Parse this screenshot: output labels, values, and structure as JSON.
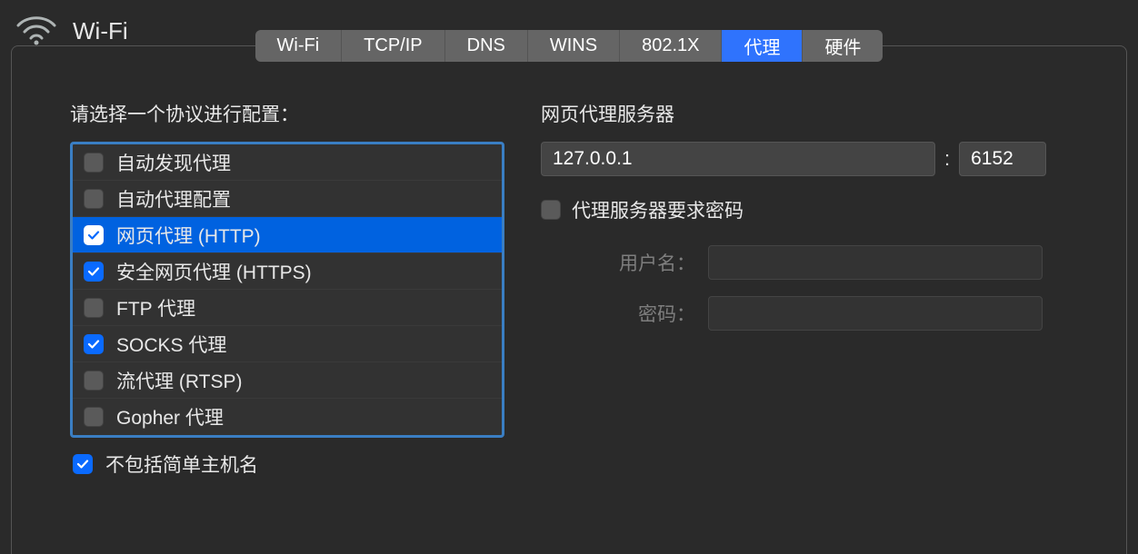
{
  "header": {
    "title": "Wi-Fi"
  },
  "tabs": [
    {
      "label": "Wi-Fi"
    },
    {
      "label": "TCP/IP"
    },
    {
      "label": "DNS"
    },
    {
      "label": "WINS"
    },
    {
      "label": "802.1X"
    },
    {
      "label": "代理"
    },
    {
      "label": "硬件"
    }
  ],
  "left": {
    "section_label": "请选择一个协议进行配置：",
    "protocols": [
      {
        "label": "自动发现代理",
        "checked": false,
        "selected": false
      },
      {
        "label": "自动代理配置",
        "checked": false,
        "selected": false
      },
      {
        "label": "网页代理 (HTTP)",
        "checked": true,
        "selected": true
      },
      {
        "label": "安全网页代理 (HTTPS)",
        "checked": true,
        "selected": false
      },
      {
        "label": "FTP 代理",
        "checked": false,
        "selected": false
      },
      {
        "label": "SOCKS 代理",
        "checked": true,
        "selected": false
      },
      {
        "label": "流代理 (RTSP)",
        "checked": false,
        "selected": false
      },
      {
        "label": "Gopher 代理",
        "checked": false,
        "selected": false
      }
    ],
    "exclude_label": "不包括简单主机名"
  },
  "right": {
    "server_label": "网页代理服务器",
    "host_value": "127.0.0.1",
    "port_value": "6152",
    "auth_label": "代理服务器要求密码",
    "username_label": "用户名：",
    "password_label": "密码："
  }
}
